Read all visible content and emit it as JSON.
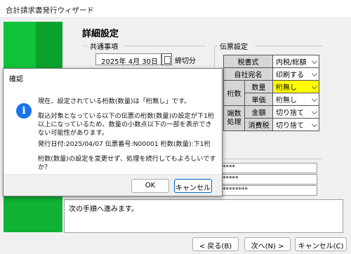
{
  "window": {
    "title": "合計請求書発行ウィザード"
  },
  "page": {
    "title": "詳細設定"
  },
  "common": {
    "heading": "共通事項",
    "date_value": "2025年 4月 30日",
    "cutoff_label": "締切分"
  },
  "slip": {
    "heading": "伝票設定",
    "rows": {
      "tax_label": "税書式",
      "tax_value": "内税/総額",
      "addr_label": "自社宛名",
      "addr_value": "印刷する",
      "digits_label": "桁数",
      "qty_label": "数量",
      "qty_value": "桁無し",
      "price_label": "単価",
      "price_value": "桁無し",
      "rounding_label": "端数処理",
      "amount_label": "金額",
      "amount_value": "切り捨て",
      "consumption_label": "消費税",
      "consumption_value": "切り捨て"
    }
  },
  "fields": {
    "f1": "****",
    "f2": "*****",
    "f3": "********"
  },
  "message": "次の手順へ進みます。",
  "buttons": {
    "back": "< 戻る(B)",
    "next": "次へ(N) >",
    "cancel": "キャンセル(C)"
  },
  "dialog": {
    "title": "確認",
    "line1": "現在、設定されている桁数(数量)は「桁無し」です。",
    "line2": "取込対象となっている以下の伝票の桁数(数量)の設定が下1桁以上になっているため、数量の小数点以下の一部を表示できない可能性があります。",
    "line3": "発行日付:2025/04/07 伝票番号:N00001 桁数(数量):下1桁",
    "line4": "桁数(数量)の設定を変更せず、処理を続行してもよろしいですか？",
    "ok": "OK",
    "cancel": "キャンセル"
  },
  "colors": {
    "accent_green": "#10c33a",
    "highlight_yellow": "#ffff00",
    "info_blue": "#1a73e8"
  }
}
